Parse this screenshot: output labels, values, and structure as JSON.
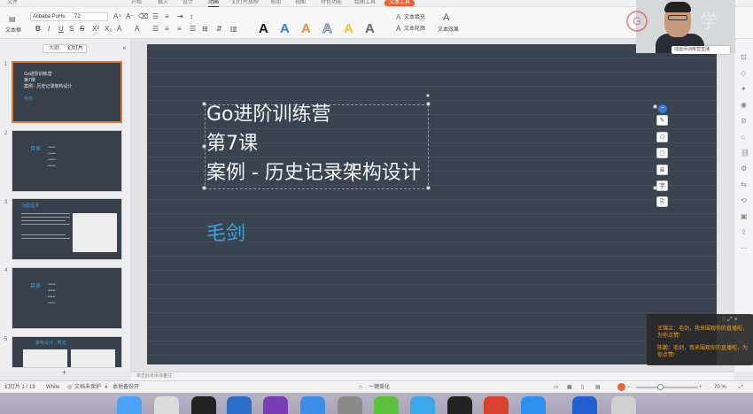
{
  "menu": {
    "items": [
      "文件",
      "开始",
      "插入",
      "设计",
      "动画",
      "幻灯片放映",
      "审阅",
      "视图",
      "特色功能",
      "绘图工具",
      "文本工具"
    ]
  },
  "ribbon": {
    "font_name": "Alibaba PuHu",
    "font_size": "72",
    "textbox_label": "文本框",
    "text_fill": "文本填充",
    "text_outline": "文本轮廓",
    "text_effect": "文本效果"
  },
  "left_panel": {
    "tab_outline": "大纲",
    "tab_slides": "幻灯片",
    "slides": [
      {
        "num": "1",
        "lines": [
          "Go进阶训练营",
          "第7课",
          "案例 - 历史记录架构设计"
        ],
        "author": "毛剑"
      },
      {
        "num": "2",
        "heading": "目录",
        "bullets": [
          "•••••",
          "•••••",
          "•••••",
          "•••••"
        ]
      },
      {
        "num": "3",
        "heading": "功能需求"
      },
      {
        "num": "4",
        "heading": "目录",
        "bullets": [
          "•••••",
          "•••••",
          "•••••",
          "•••••"
        ]
      },
      {
        "num": "5",
        "heading": "架构设计 - 概览"
      }
    ]
  },
  "slide": {
    "line1": "Go进阶训练营",
    "line2": "第7课",
    "line3": "案例 - 历史记录架构设计",
    "author": "毛剑"
  },
  "notes_placeholder": "单击此处添加备注",
  "status": {
    "slide_counter": "幻灯片 1 / 19",
    "theme": "White",
    "doc_protect": "文档未保护",
    "backup": "本地备份开",
    "beautify": "一键美化",
    "zoom": "70 %"
  },
  "webcam": {
    "label": "插画师训练营直播"
  },
  "chat": {
    "messages": [
      "王锦兰：毛剑，我来围观你的直播啦，为你点赞!",
      "陈鹏：毛剑，我来围观你的直播啦，为你点赞!"
    ]
  },
  "colors": {
    "slide_bg": "#3a4350",
    "accent": "#3aa3dd",
    "selected_border": "#e2773a",
    "chat_text": "#f2a01e"
  }
}
